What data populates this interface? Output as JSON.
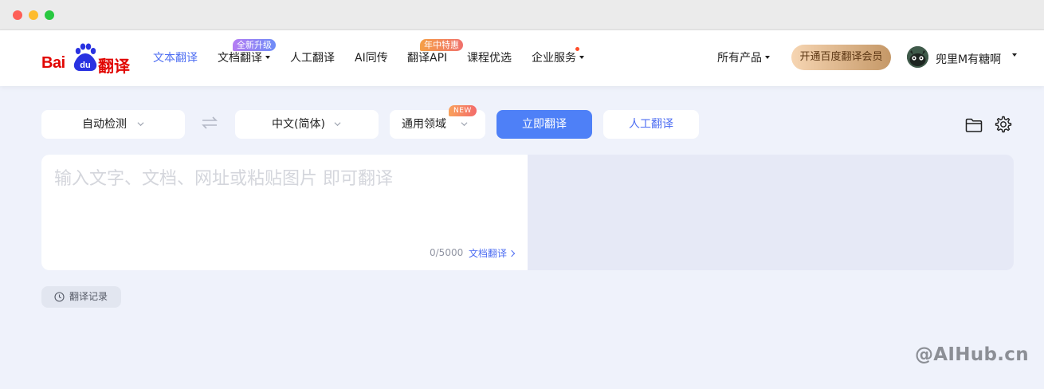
{
  "window": {
    "controls": [
      "close",
      "minimize",
      "zoom"
    ]
  },
  "header": {
    "logo": {
      "bai": "Bai",
      "du": "du",
      "fanyi": "翻译"
    },
    "nav": [
      {
        "label": "文本翻译",
        "active": true
      },
      {
        "label": "文档翻译",
        "has_dropdown": true,
        "badge": "全新升级"
      },
      {
        "label": "人工翻译"
      },
      {
        "label": "AI同传"
      },
      {
        "label": "翻译API",
        "badge": "年中特惠"
      },
      {
        "label": "课程优选"
      },
      {
        "label": "企业服务",
        "has_dropdown": true,
        "dot": true
      }
    ],
    "all_products": "所有产品",
    "vip_button": "开通百度翻译会员",
    "user_name": "兜里M有糖啊"
  },
  "toolbar": {
    "source_lang": "自动检测",
    "target_lang": "中文(简体)",
    "domain": "通用领域",
    "domain_badge": "NEW",
    "translate_button": "立即翻译",
    "human_button": "人工翻译",
    "icons": [
      "folder-icon",
      "settings-gear-icon"
    ]
  },
  "input": {
    "placeholder": "输入文字、文档、网址或粘贴图片 即可翻译",
    "counter": "0/5000",
    "doc_link": "文档翻译"
  },
  "history": {
    "label": "翻译记录"
  },
  "watermark": "@AIHub.cn",
  "colors": {
    "accent": "#4e6ef2",
    "primary_button": "#4e80f7",
    "brand_red": "#e10602",
    "page_bg": "#eff2fb"
  }
}
